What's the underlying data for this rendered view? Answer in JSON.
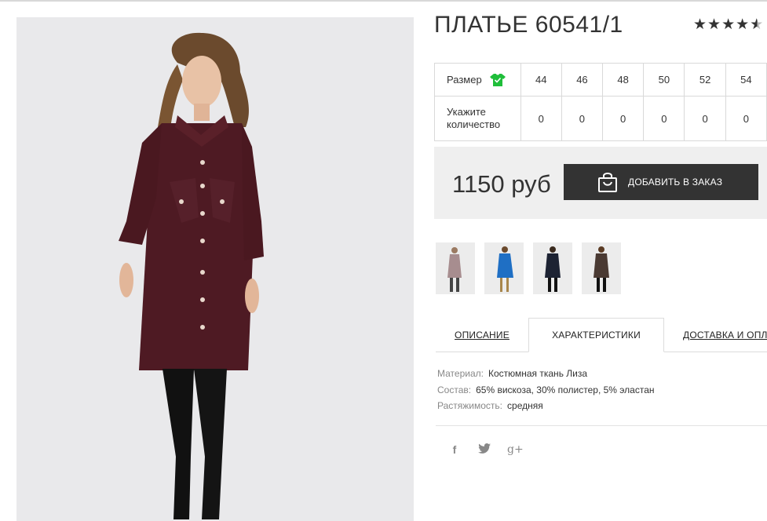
{
  "product": {
    "title": "ПЛАТЬЕ 60541/1",
    "rating": 4.5,
    "rating_max": 5
  },
  "sizes": {
    "row_label": "Размер",
    "values": [
      "44",
      "46",
      "48",
      "50",
      "52",
      "54"
    ],
    "qty_label": "Укажите количество",
    "quantities": [
      "0",
      "0",
      "0",
      "0",
      "0",
      "0"
    ]
  },
  "price": {
    "text": "1150 руб",
    "add_button": "ДОБАВИТЬ В ЗАКАЗ"
  },
  "thumbnails": [
    {
      "name": "dress-thumb-mauve",
      "color": "#a78d8f"
    },
    {
      "name": "dress-thumb-blue",
      "color": "#1f6fc4"
    },
    {
      "name": "dress-thumb-navy",
      "color": "#1d2333"
    },
    {
      "name": "dress-thumb-check",
      "color": "#4a3a33"
    }
  ],
  "tabs": [
    "ОПИСАНИЕ",
    "ХАРАКТЕРИСТИКИ",
    "ДОСТАВКА И ОПЛА"
  ],
  "active_tab": 1,
  "characteristics": [
    {
      "key": "Материал:",
      "value": "Костюмная ткань Лиза"
    },
    {
      "key": "Состав:",
      "value": "65% вискоза, 30% полистер, 5% эластан"
    },
    {
      "key": "Растяжимость:",
      "value": "средняя"
    }
  ],
  "social": [
    {
      "icon": "facebook-icon",
      "glyph": "f"
    },
    {
      "icon": "twitter-icon",
      "glyph": "t"
    },
    {
      "icon": "google-plus-icon",
      "glyph": "g+"
    }
  ],
  "colors": {
    "dress": "#4e1a23",
    "button": "#333333",
    "price_bg": "#efefef",
    "size_icon": "#1fbe3a"
  }
}
